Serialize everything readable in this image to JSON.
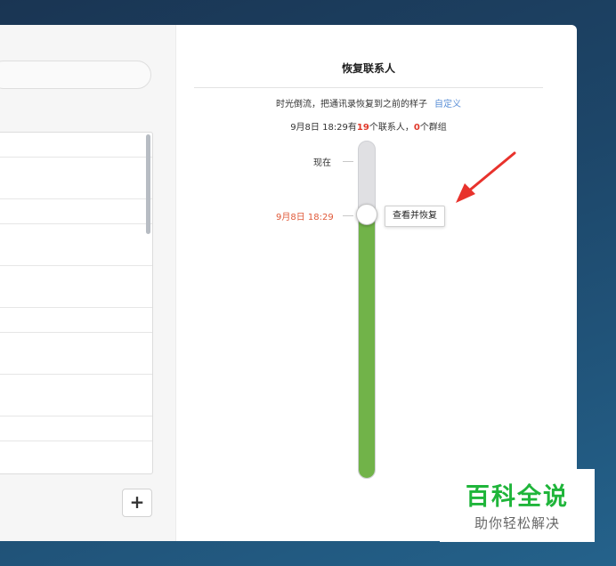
{
  "panel": {
    "title": "恢复联系人",
    "description": "时光倒流，把通讯录恢复到之前的样子",
    "customize_link": "自定义",
    "summary": {
      "date_time": "9月8日 18:29有",
      "contact_count": "19",
      "contacts_suffix": "个联系人，",
      "group_count": "0",
      "groups_suffix": "个群组"
    }
  },
  "timeline": {
    "now_label": "现在",
    "selected_label": "9月8日 18:29",
    "restore_button": "查看并恢复",
    "fill_fraction": 0.81,
    "colors": {
      "fill": "#71b349",
      "track": "#e0e0e3",
      "selected_text": "#e05a3a"
    }
  },
  "left_panel": {
    "add_button": "+"
  },
  "annotation": {
    "arrow_color": "#e8322c"
  },
  "watermark": {
    "main": "百科全说",
    "sub": "助你轻松解决"
  }
}
